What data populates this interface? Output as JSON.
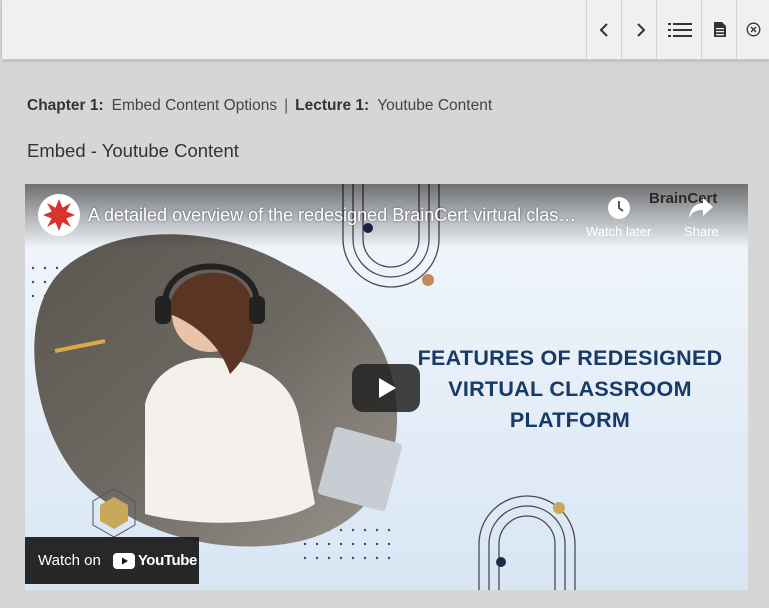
{
  "toolbar": {
    "prev_icon": "chevron-left-icon",
    "next_icon": "chevron-right-icon",
    "list_icon": "list-icon",
    "doc_icon": "document-icon",
    "close_icon": "close-circle-icon"
  },
  "breadcrumb": {
    "chapter_label": "Chapter 1:",
    "chapter_title": "Embed Content Options",
    "separator": "|",
    "lecture_label": "Lecture 1:",
    "lecture_title": "Youtube Content"
  },
  "page": {
    "title": "Embed - Youtube Content"
  },
  "video": {
    "title": "A detailed overview of the redesigned BrainCert virtual classroom platform",
    "watch_later": "Watch later",
    "share": "Share",
    "brand": "BrainCert",
    "headline": [
      "FEATURES OF REDESIGNED",
      "VIRTUAL CLASSROOM",
      "PLATFORM"
    ],
    "watch_on": "Watch on",
    "youtube": "YouTube"
  },
  "colors": {
    "headline": "#183a66",
    "youtube_red": "#ff0000",
    "toolbar_bg": "#f0f0f0"
  }
}
